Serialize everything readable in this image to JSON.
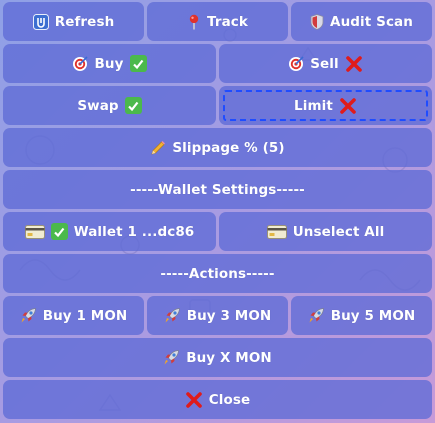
{
  "keyboard": {
    "refresh": "Refresh",
    "track": "Track",
    "audit_scan": "Audit Scan",
    "buy": "Buy",
    "sell": "Sell",
    "swap": "Swap",
    "limit": "Limit",
    "slippage": "Slippage % (5)",
    "wallet_settings": "-----Wallet Settings-----",
    "wallet_1": "Wallet 1 ...dc86",
    "unselect_all": "Unselect All",
    "actions": "-----Actions-----",
    "buy_1": "Buy 1 MON",
    "buy_3": "Buy 3 MON",
    "buy_5": "Buy 5 MON",
    "buy_x": "Buy X MON",
    "close": "Close"
  },
  "icons": {
    "refresh": "refresh-icon",
    "track": "pin-icon",
    "audit": "shield-icon",
    "target": "target-icon",
    "check": "check-icon",
    "cross": "cross-icon",
    "pencil": "pencil-icon",
    "card": "credit-card-icon",
    "rocket": "rocket-icon"
  },
  "colors": {
    "button": "#5f6cd6",
    "check": "#4bb94b",
    "cross": "#e01b1b",
    "selected_outline": "#1f4cff"
  }
}
